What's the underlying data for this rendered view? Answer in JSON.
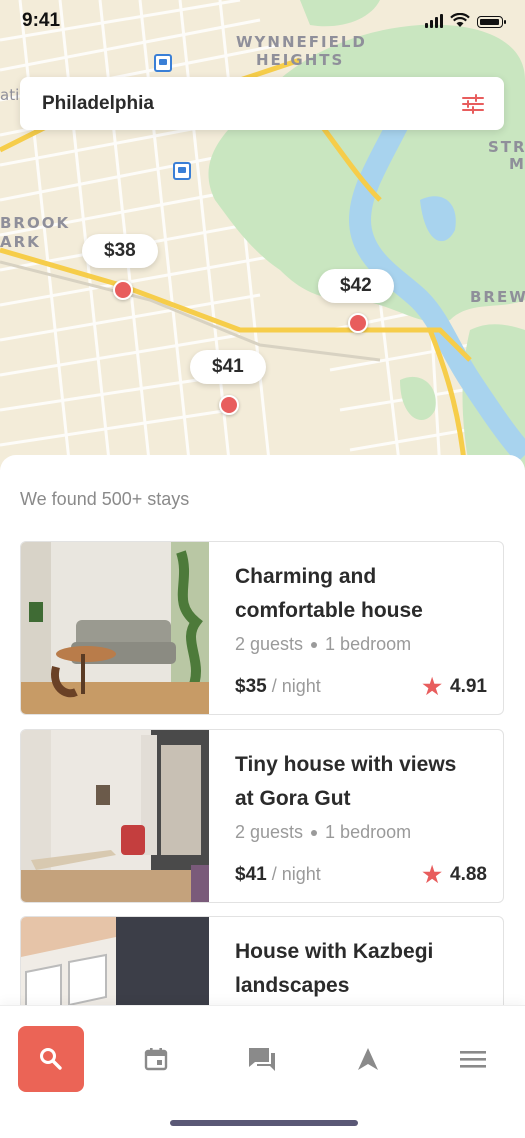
{
  "status_bar": {
    "time": "9:41"
  },
  "map": {
    "labels": {
      "wynnefield": "WYNNEFIELD",
      "heights": "HEIGHTS",
      "brook": "BROOK",
      "park": "ARK",
      "str": "STR",
      "m": "M",
      "brew": "BREW",
      "atic": "atic"
    },
    "pins": [
      {
        "price": "$38"
      },
      {
        "price": "$42"
      },
      {
        "price": "$41"
      }
    ],
    "colors": {
      "land": "#f3ecd9",
      "park": "#c9e6c0",
      "water": "#a8d3ee",
      "highway": "#f6cd4a",
      "pin": "#e85d5d"
    }
  },
  "search": {
    "location": "Philadelphia",
    "filter_icon": "sliders-icon"
  },
  "results": {
    "count_text": "We found 500+ stays",
    "listings": [
      {
        "title_line1": "Charming and",
        "title_line2": "comfortable house",
        "guests": "2 guests",
        "bedrooms": "1 bedroom",
        "price": "$35",
        "per": "/ night",
        "rating": "4.91"
      },
      {
        "title_line1": "Tiny house with views",
        "title_line2": "at Gora Gut",
        "guests": "2 guests",
        "bedrooms": "1 bedroom",
        "price": "$41",
        "per": "/ night",
        "rating": "4.88"
      },
      {
        "title_line1": "House with Kazbegi",
        "title_line2": "landscapes"
      }
    ]
  },
  "tab_bar": {
    "tabs": [
      {
        "icon": "search-icon",
        "active": true
      },
      {
        "icon": "calendar-icon"
      },
      {
        "icon": "chat-icon"
      },
      {
        "icon": "navigation-icon"
      },
      {
        "icon": "menu-icon"
      }
    ],
    "accent": "#eb6456"
  }
}
